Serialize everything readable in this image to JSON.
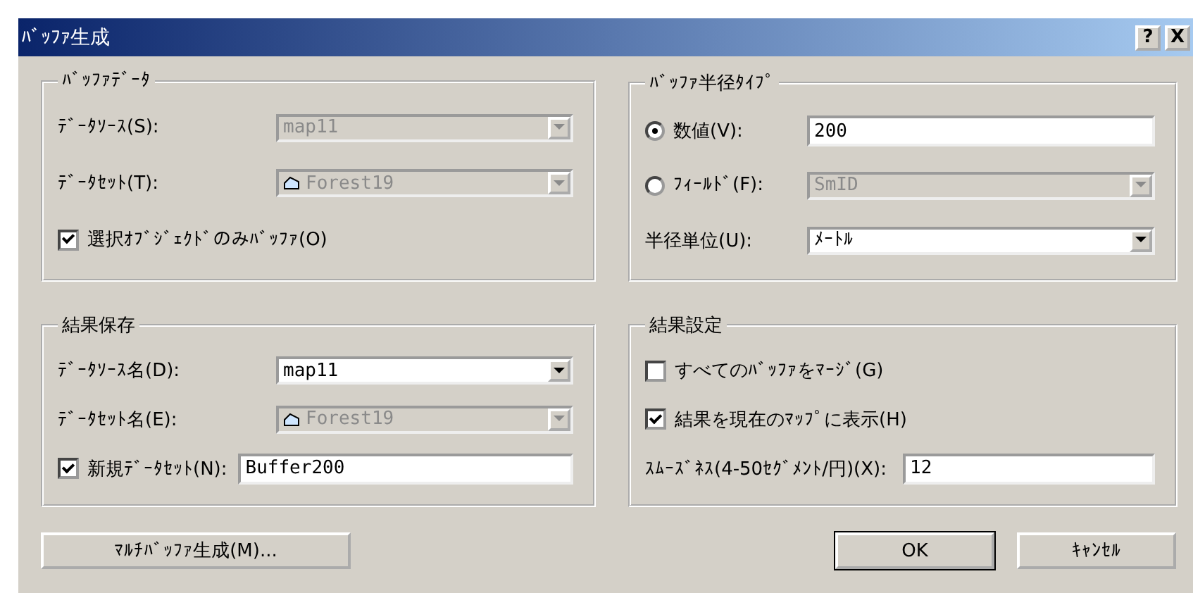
{
  "window": {
    "title": "ﾊﾞｯﾌｧ生成",
    "help": "?",
    "close": "X"
  },
  "groups": [
    {
      "title": "ﾊﾞｯﾌｧﾃﾞｰﾀ",
      "rows": [
        {
          "kind": "field",
          "label": "ﾃﾞｰﾀｿｰｽ(S):",
          "control": {
            "kind": "combo",
            "value": "map11",
            "disabled": true
          }
        },
        {
          "kind": "field",
          "label": "ﾃﾞｰﾀｾｯﾄ(T):",
          "control": {
            "kind": "combo",
            "value": "Forest19",
            "disabled": true,
            "dataset_icon": true
          }
        },
        {
          "kind": "inline",
          "toggle": {
            "kind": "checkbox",
            "checked": true
          },
          "label": "選択ｵﾌﾞｼﾞｪｸﾄﾞのみﾊﾞｯﾌｧ(O)"
        }
      ]
    },
    {
      "title": "ﾊﾞｯﾌｧ半径ﾀｲﾌﾟ",
      "rows": [
        {
          "kind": "field",
          "toggle": {
            "kind": "radio",
            "selected": true
          },
          "label": "数値(V):",
          "control": {
            "kind": "text",
            "value": "200",
            "disabled": false
          }
        },
        {
          "kind": "field",
          "toggle": {
            "kind": "radio",
            "selected": false
          },
          "label": "ﾌｨｰﾙﾄﾞ(F):",
          "control": {
            "kind": "combo",
            "value": "SmID",
            "disabled": true
          }
        },
        {
          "kind": "field",
          "label": "半径単位(U):",
          "control": {
            "kind": "combo",
            "value": "ﾒｰﾄﾙ",
            "disabled": false
          }
        }
      ]
    },
    {
      "title": "結果保存",
      "rows": [
        {
          "kind": "field",
          "label": "ﾃﾞｰﾀｿｰｽ名(D):",
          "control": {
            "kind": "combo",
            "value": "map11",
            "disabled": false
          }
        },
        {
          "kind": "field",
          "label": "ﾃﾞｰﾀｾｯﾄ名(E):",
          "control": {
            "kind": "combo",
            "value": "Forest19",
            "disabled": true,
            "dataset_icon": true
          }
        },
        {
          "kind": "inline",
          "toggle": {
            "kind": "checkbox",
            "checked": true
          },
          "label": "新規ﾃﾞｰﾀｾｯﾄ(N):",
          "control": {
            "kind": "text",
            "value": "Buffer200",
            "disabled": false
          }
        }
      ]
    },
    {
      "title": "結果設定",
      "rows": [
        {
          "kind": "inline",
          "toggle": {
            "kind": "checkbox",
            "checked": false
          },
          "label": "すべてのﾊﾞｯﾌｧをﾏｰｼﾞ(G)"
        },
        {
          "kind": "inline",
          "toggle": {
            "kind": "checkbox",
            "checked": true
          },
          "label": "結果を現在のﾏｯﾌﾟに表示(H)"
        },
        {
          "kind": "short",
          "label": "ｽﾑｰｽﾞﾈｽ(4-50ｾｸﾞﾒﾝﾄ/円)(X):",
          "control": {
            "kind": "text",
            "value": "12",
            "disabled": false
          }
        }
      ]
    }
  ],
  "buttons": [
    {
      "label": "ﾏﾙﾁﾊﾞｯﾌｧ生成(M)...",
      "default": false
    },
    {
      "label": "OK",
      "default": true
    },
    {
      "label": "ｷｬﾝｾﾙ",
      "default": false
    }
  ]
}
